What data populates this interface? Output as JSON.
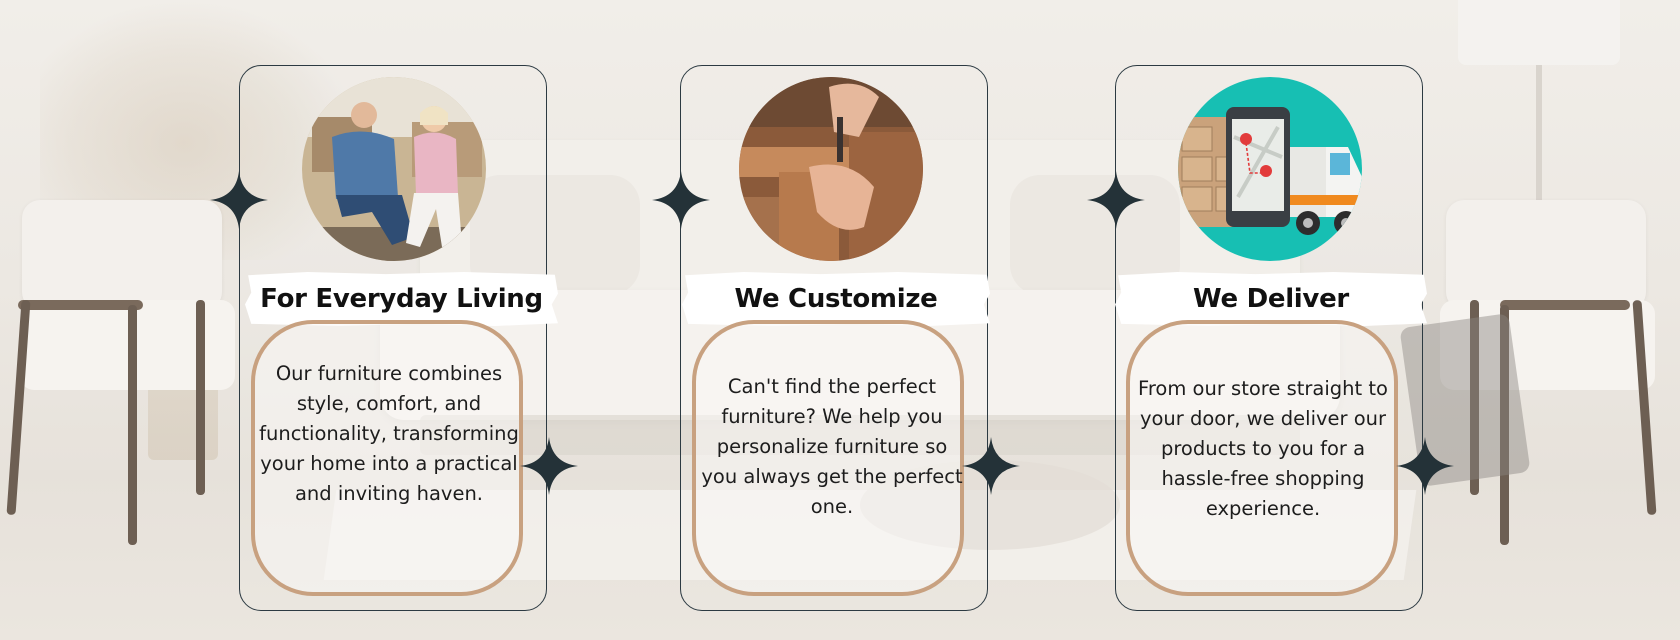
{
  "palette": {
    "card_border": "#2c3a42",
    "inner_border": "#c8a180",
    "star": "#243238",
    "banner": "#ffffff",
    "text": "#1d1d1d"
  },
  "cards": [
    {
      "title": "For Everyday Living",
      "image_icon": "senior-couple-on-chairs-photo",
      "description": "Our furniture combines style, comfort, and functionality, transforming your home into a practical and inviting haven."
    },
    {
      "title": "We Customize",
      "image_icon": "woodworking-hands-photo",
      "description": "Can't find the perfect furniture? We help you personalize furniture so you always get the perfect one."
    },
    {
      "title": "We Deliver",
      "image_icon": "delivery-truck-phone-map-illustration",
      "description": "From our store straight to your door, we deliver our products to you for a hassle-free shopping experience."
    }
  ]
}
